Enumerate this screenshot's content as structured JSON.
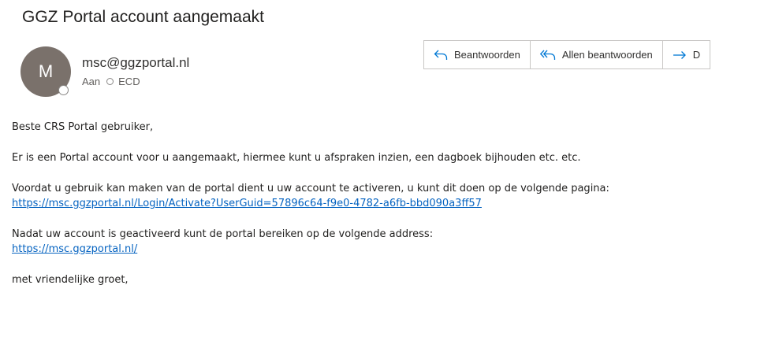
{
  "email": {
    "subject": "GGZ Portal account aangemaakt",
    "sender": "msc@ggzportal.nl",
    "avatar_initial": "M",
    "to_label": "Aan",
    "recipient": "ECD"
  },
  "actions": {
    "reply": "Beantwoorden",
    "reply_all": "Allen beantwoorden",
    "forward": "D"
  },
  "body": {
    "greeting": "Beste CRS Portal gebruiker,",
    "para1": "Er is een Portal account voor u aangemaakt, hiermee kunt u afspraken inzien, een dagboek bijhouden etc. etc.",
    "para2": "Voordat u gebruik kan maken van de portal dient u uw account te activeren, u kunt dit doen op de volgende pagina:",
    "activate_link": "https://msc.ggzportal.nl/Login/Activate?UserGuid=57896c64-f9e0-4782-a6fb-bbd090a3ff57",
    "para3": "Nadat uw account is geactiveerd kunt de portal bereiken op de volgende address:",
    "portal_link": "https://msc.ggzportal.nl/",
    "closing": "met vriendelijke groet,"
  },
  "colors": {
    "link": "#0563c1",
    "accent": "#0078d4",
    "avatar": "#7a716b"
  }
}
